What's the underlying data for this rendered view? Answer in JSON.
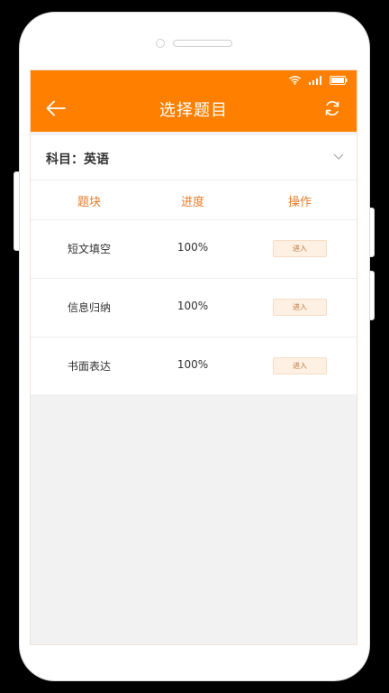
{
  "header": {
    "title": "选择题目",
    "back_icon": "arrow-left-icon",
    "refresh_icon": "refresh-icon",
    "bg_color": "#ff7f00"
  },
  "status_bar": {
    "icons": [
      "wifi-icon",
      "signal-icon",
      "battery-icon"
    ]
  },
  "subject": {
    "label": "科目：",
    "value": "英语",
    "dropdown_icon": "chevron-down-icon"
  },
  "table": {
    "columns": [
      "题块",
      "进度",
      "操作"
    ],
    "rows": [
      {
        "name": "短文填空",
        "progress": "100%",
        "action": "进入"
      },
      {
        "name": "信息归纳",
        "progress": "100%",
        "action": "进入"
      },
      {
        "name": "书面表达",
        "progress": "100%",
        "action": "进入"
      }
    ]
  },
  "colors": {
    "accent": "#ff7f00",
    "column_header": "#e87d2a",
    "button_bg": "#fef1e4",
    "content_bg": "#f2f2f2"
  }
}
